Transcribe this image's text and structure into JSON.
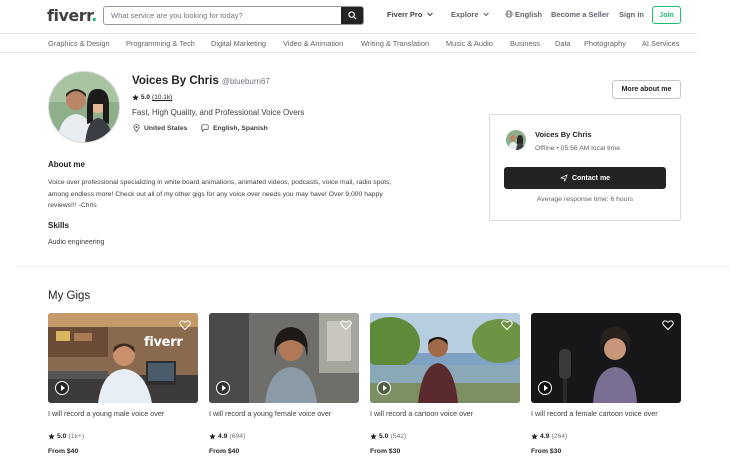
{
  "header": {
    "logo": "fiverr",
    "search_placeholder": "What service are you looking for today?",
    "nav": {
      "fiverr_pro": "Fiverr Pro",
      "explore": "Explore",
      "language": "English",
      "become_seller": "Become a Seller",
      "sign_in": "Sign in",
      "join": "Join"
    }
  },
  "categories": [
    "Graphics & Design",
    "Programming & Tech",
    "Digital Marketing",
    "Video & Animation",
    "Writing & Translation",
    "Music & Audio",
    "Business",
    "Data",
    "Photography",
    "AI Services"
  ],
  "profile": {
    "name": "Voices By Chris",
    "handle": "@blueburn67",
    "rating": "5.0",
    "review_count": "(10.1k)",
    "tagline": "Fast, High Quality, and Professional Voice Overs",
    "location": "United States",
    "languages": "English, Spanish",
    "more_about_label": "More about me"
  },
  "contact_card": {
    "name": "Voices By Chris",
    "status": "Offline • 05:56 AM local time",
    "button_label": "Contact me",
    "response_time": "Average response time: 6 hours"
  },
  "about": {
    "heading": "About me",
    "text": "Voice over professional specializing in white board animations, animated videos, podcasts, voice mail, radio spots, among endless more! Check out all of my other gigs for any voice over needs you may have! Over 9,000 happy reviews!!! -Chris"
  },
  "skills": {
    "heading": "Skills",
    "items": [
      "Audio engineering"
    ]
  },
  "gigs": {
    "heading": "My Gigs",
    "items": [
      {
        "title": "I will record a young male voice over",
        "rating": "5.0",
        "count": "(1k+)",
        "price": "From $40",
        "watermark": "fiverr"
      },
      {
        "title": "I will record a young female voice over",
        "rating": "4.9",
        "count": "(694)",
        "price": "From $40"
      },
      {
        "title": "I will record a cartoon voice over",
        "rating": "5.0",
        "count": "(542)",
        "price": "From $30"
      },
      {
        "title": "I will record a female cartoon voice over",
        "rating": "4.9",
        "count": "(264)",
        "price": "From $30"
      }
    ]
  },
  "colors": {
    "brand_green": "#1dbf73",
    "dark": "#222325",
    "text": "#404145"
  }
}
